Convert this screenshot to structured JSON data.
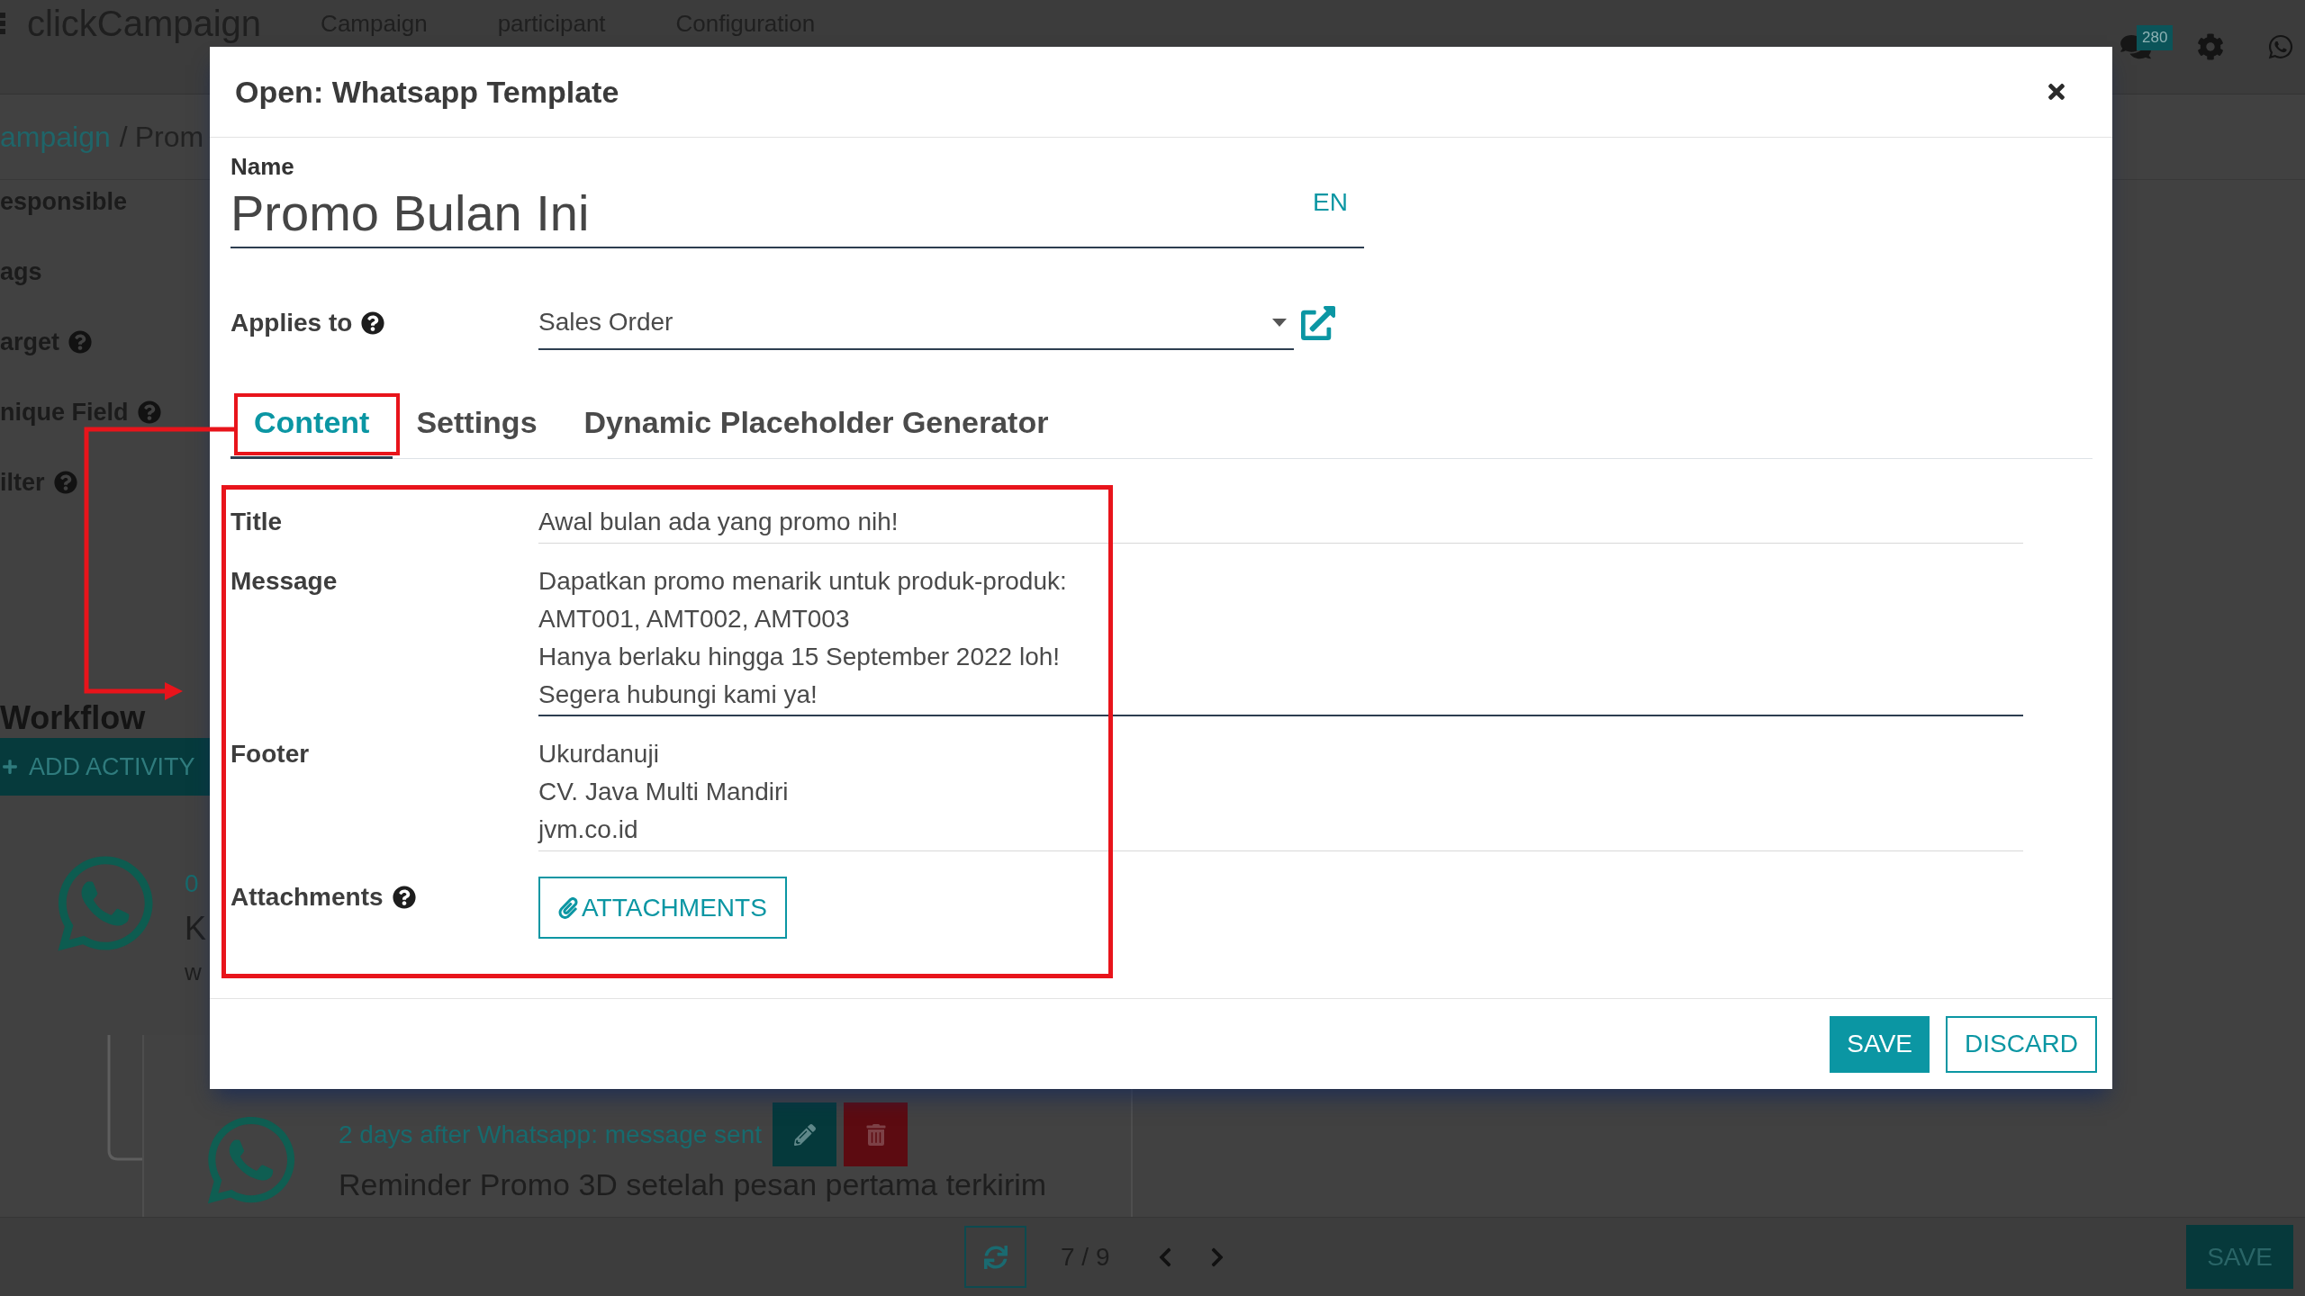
{
  "navbar": {
    "app_name": "clickCampaign",
    "menu": [
      "Campaign",
      "participant",
      "Configuration"
    ],
    "message_count": "280"
  },
  "breadcrumb": {
    "parent": "ampaign",
    "separator": "/",
    "current": "Prom"
  },
  "form_labels": [
    {
      "label": "esponsible",
      "help": false
    },
    {
      "label": "ags",
      "help": false
    },
    {
      "label": "arget",
      "help": true
    },
    {
      "label": "nique Field",
      "help": true
    },
    {
      "label": "ilter",
      "help": true
    }
  ],
  "workflow": {
    "heading": "Workflow",
    "add_button": "ADD ACTIVITY",
    "activities": [
      {
        "trigger": "0",
        "name": "K",
        "detail": "w"
      },
      {
        "trigger": "2 days after Whatsapp: message sent",
        "name": "Reminder Promo 3D setelah pesan pertama terkirim"
      }
    ]
  },
  "pager": {
    "value": "7 / 9"
  },
  "save_button": "SAVE",
  "dialog": {
    "title": "Open: Whatsapp Template",
    "name_label": "Name",
    "name_value": "Promo Bulan Ini",
    "language": "EN",
    "applies_to": {
      "label": "Applies to",
      "help": true,
      "value": "Sales Order"
    },
    "tabs": [
      {
        "label": "Content",
        "selected": true
      },
      {
        "label": "Settings",
        "selected": false
      },
      {
        "label": "Dynamic Placeholder Generator",
        "selected": false
      }
    ],
    "fields": [
      {
        "label": "Title",
        "value": "Awal bulan ada yang promo nih!",
        "focused": false
      },
      {
        "label": "Message",
        "value": "Dapatkan promo menarik untuk produk-produk:\nAMT001, AMT002, AMT003\nHanya berlaku hingga 15 September 2022 loh!\nSegera hubungi kami ya!",
        "focused": true
      },
      {
        "label": "Footer",
        "value": "Ukurdanuji\nCV. Java Multi Mandiri\njvm.co.id",
        "focused": false
      }
    ],
    "attachments": {
      "label": "Attachments",
      "help": true,
      "button": "ATTACHMENTS"
    },
    "buttons": [
      {
        "label": "SAVE",
        "kind": "primary"
      },
      {
        "label": "DISCARD",
        "kind": "secondary"
      }
    ]
  }
}
